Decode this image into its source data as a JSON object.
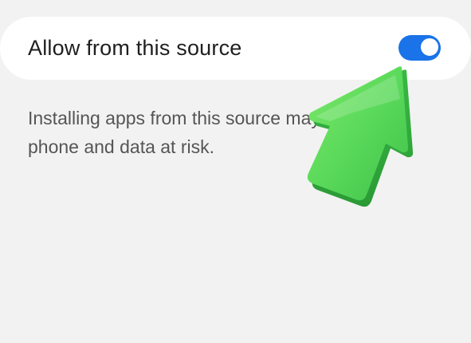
{
  "setting": {
    "label": "Allow from this source",
    "toggle_state": "on",
    "accent_color": "#1a73e8"
  },
  "warning": {
    "line1": "Installing apps from this source may p",
    "line2": "phone and data at risk."
  },
  "overlay": {
    "arrow_icon": "pointer-arrow-icon",
    "arrow_color": "#4cd964"
  }
}
